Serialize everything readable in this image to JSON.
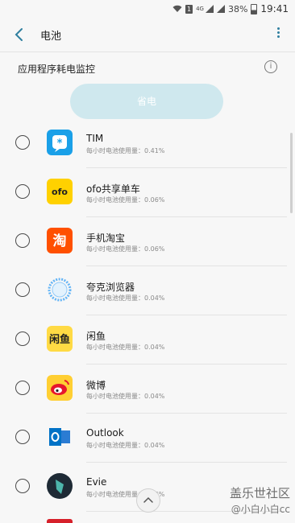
{
  "statusbar": {
    "network": "4G",
    "battery": "38%",
    "time": "19:41"
  },
  "appbar": {
    "title": "电池"
  },
  "section": {
    "title": "应用程序耗电监控"
  },
  "save_button": {
    "label": "省电"
  },
  "apps": [
    {
      "name": "TIM",
      "usage": "每小时电池使用量：0.41%",
      "icon": "tim-icon",
      "color": "#1aa0e8"
    },
    {
      "name": "ofo共享单车",
      "usage": "每小时电池使用量：0.06%",
      "icon": "ofo-icon",
      "color": "#ffd100"
    },
    {
      "name": "手机淘宝",
      "usage": "每小时电池使用量：0.06%",
      "icon": "taobao-icon",
      "color": "#ff5000"
    },
    {
      "name": "夸克浏览器",
      "usage": "每小时电池使用量：0.04%",
      "icon": "quark-icon",
      "color": "#64b5f6"
    },
    {
      "name": "闲鱼",
      "usage": "每小时电池使用量：0.04%",
      "icon": "xianyu-icon",
      "color": "#ffda44"
    },
    {
      "name": "微博",
      "usage": "每小时电池使用量：0.04%",
      "icon": "weibo-icon",
      "color": "#e6162d"
    },
    {
      "name": "Outlook",
      "usage": "每小时电池使用量：0.04%",
      "icon": "outlook-icon",
      "color": "#0072c6"
    },
    {
      "name": "Evie",
      "usage": "每小时电池使用量：0.04%",
      "icon": "evie-icon",
      "color": "#1e2a35"
    }
  ],
  "watermark": {
    "line1": "盖乐世社区",
    "line2": "@小白小白cc"
  }
}
